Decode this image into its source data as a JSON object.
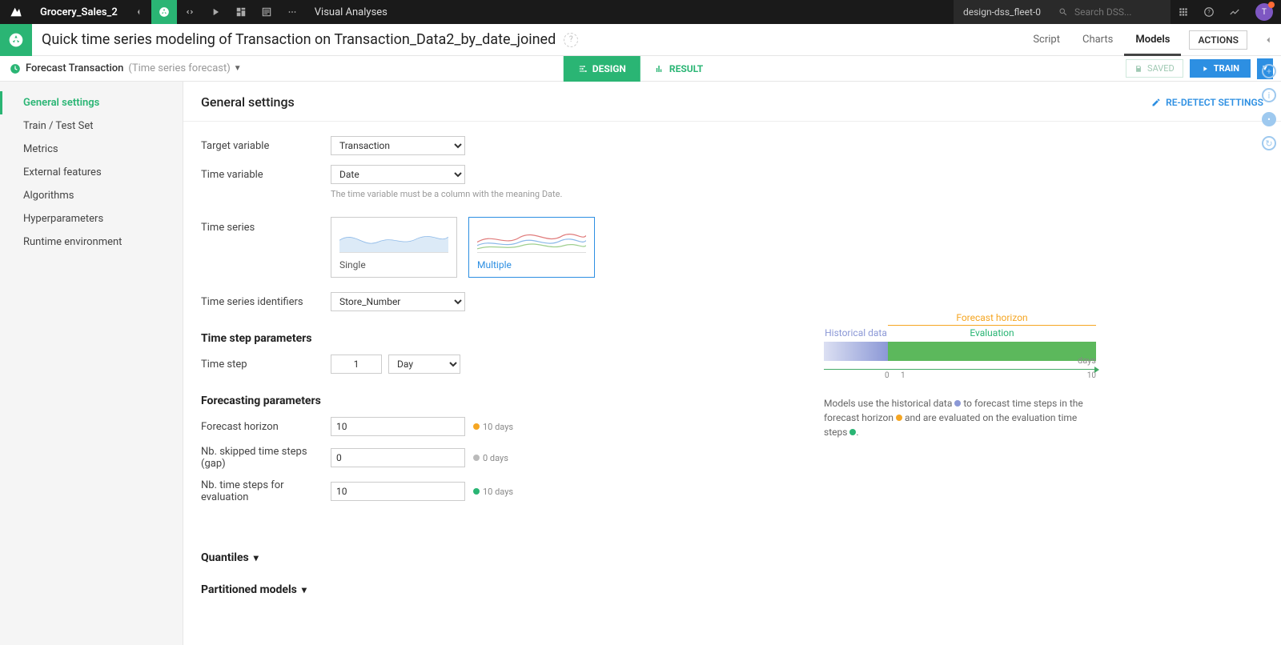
{
  "topbar": {
    "project": "Grocery_Sales_2",
    "breadcrumb": "Visual Analyses",
    "instance": "design-dss_fleet-0",
    "search_placeholder": "Search DSS...",
    "avatar_initial": "T"
  },
  "titlebar": {
    "title": "Quick time series modeling of Transaction on Transaction_Data2_by_date_joined",
    "tabs": {
      "script": "Script",
      "charts": "Charts",
      "models": "Models"
    },
    "actions": "ACTIONS"
  },
  "subheader": {
    "task_name": "Forecast Transaction",
    "task_type": "(Time series forecast)",
    "design": "DESIGN",
    "result": "RESULT",
    "saved": "SAVED",
    "train": "TRAIN"
  },
  "sidenav": {
    "general": "General settings",
    "train_test": "Train / Test Set",
    "metrics": "Metrics",
    "external": "External features",
    "algorithms": "Algorithms",
    "hyper": "Hyperparameters",
    "runtime": "Runtime environment"
  },
  "main": {
    "heading": "General settings",
    "redetect": "RE-DETECT SETTINGS",
    "labels": {
      "target": "Target variable",
      "time": "Time variable",
      "time_help": "The time variable must be a column with the meaning Date.",
      "series": "Time series",
      "series_single": "Single",
      "series_multiple": "Multiple",
      "identifiers": "Time series identifiers",
      "sec_timestep": "Time step parameters",
      "timestep": "Time step",
      "sec_forecast": "Forecasting parameters",
      "horizon": "Forecast horizon",
      "gap": "Nb. skipped time steps (gap)",
      "eval": "Nb. time steps for evaluation",
      "quantiles": "Quantiles",
      "partitioned": "Partitioned models"
    },
    "values": {
      "target": "Transaction",
      "time": "Date",
      "identifiers": "Store_Number",
      "timestep_n": "1",
      "timestep_unit": "Day",
      "horizon": "10",
      "horizon_hint": "10 days",
      "gap": "0",
      "gap_hint": "0 days",
      "eval": "10",
      "eval_hint": "10 days"
    },
    "viz": {
      "fh": "Forecast horizon",
      "hist": "Historical data",
      "eval": "Evaluation",
      "unit": "days",
      "t0": "0",
      "t1": "1",
      "t2": "10",
      "desc_1": "Models use the historical data ",
      "desc_2": " to forecast time steps in the forecast horizon ",
      "desc_3": " and are evaluated on the evaluation time steps ",
      "period": "."
    }
  }
}
